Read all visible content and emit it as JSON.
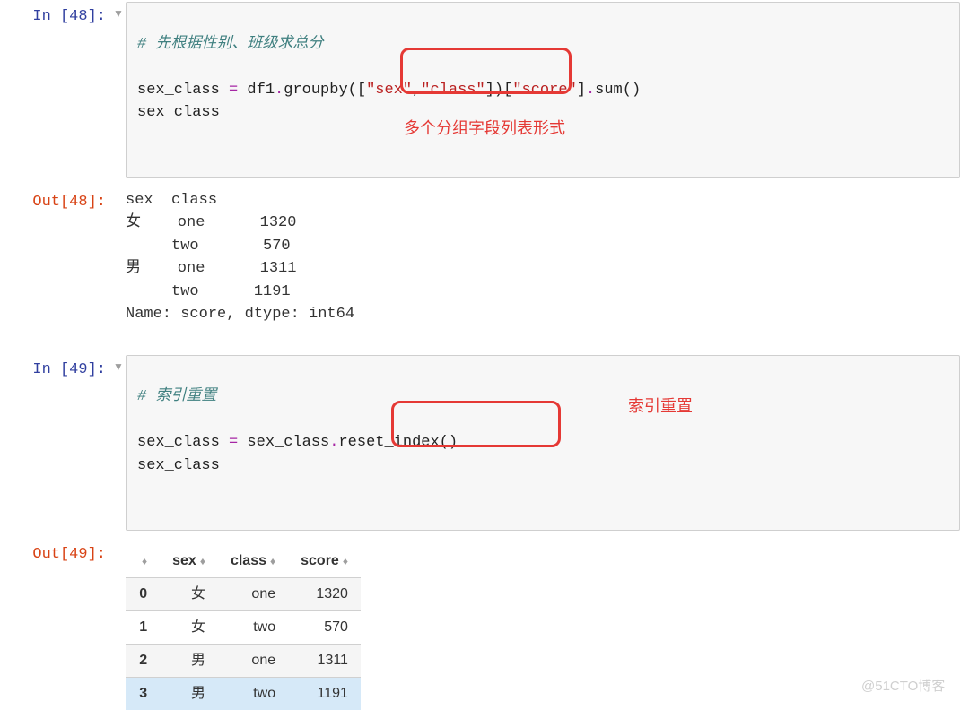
{
  "cell48": {
    "in_prompt": "In [48]:",
    "out_prompt": "Out[48]:",
    "comment": "# 先根据性别、班级求总分",
    "code_pre": "sex_class ",
    "code_op1": "=",
    "code_mid1": " df1",
    "code_dot1": ".",
    "code_func1": "groupby(",
    "code_grp_open": "[",
    "code_str1": "\"sex\"",
    "code_comma": ",",
    "code_str2": "\"class\"",
    "code_grp_close": "]",
    "code_close1": ")[",
    "code_str3": "\"score\"",
    "code_close2": "]",
    "code_dot2": ".",
    "code_func2": "sum()",
    "code_line2": "sex_class",
    "annotation": "多个分组字段列表形式",
    "output": "sex  class\n女    one      1320\n     two       570\n男    one      1311\n     two      1191\nName: score, dtype: int64"
  },
  "cell49": {
    "in_prompt": "In [49]:",
    "out_prompt": "Out[49]:",
    "comment": "# 索引重置",
    "code_pre": "sex_class ",
    "code_op1": "=",
    "code_mid1": " sex_class",
    "code_dot1": ".",
    "code_func1": "reset_index()",
    "code_line2": "sex_class",
    "annotation": "索引重置"
  },
  "df": {
    "columns": [
      "sex",
      "class",
      "score"
    ],
    "rows": [
      {
        "idx": "0",
        "sex": "女",
        "class": "one",
        "score": "1320"
      },
      {
        "idx": "1",
        "sex": "女",
        "class": "two",
        "score": "570"
      },
      {
        "idx": "2",
        "sex": "男",
        "class": "one",
        "score": "1311"
      },
      {
        "idx": "3",
        "sex": "男",
        "class": "two",
        "score": "1191"
      }
    ]
  },
  "watermark": "@51CTO博客"
}
